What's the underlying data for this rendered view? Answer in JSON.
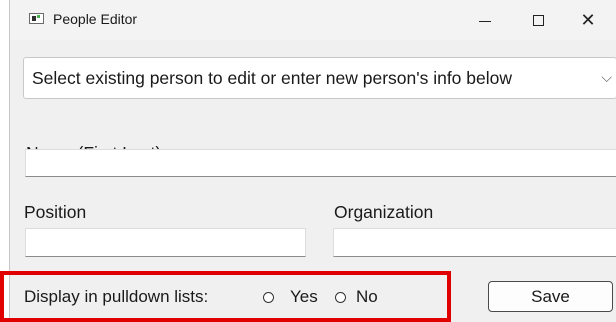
{
  "window": {
    "title": "People Editor",
    "controls": {
      "minimize_icon": "minimize-icon",
      "maximize_icon": "maximize-icon",
      "close_symbol": "✕"
    }
  },
  "person_select": {
    "value": "Select existing person to edit or enter new person's info below",
    "arrow": "⌵"
  },
  "fields": {
    "name_label": "Name (First Last)",
    "name_value": "",
    "position_label": "Position",
    "position_value": "",
    "organization_label": "Organization",
    "organization_value": ""
  },
  "display_option": {
    "label": "Display in pulldown lists:",
    "yes_label": "Yes",
    "no_label": "No",
    "selected": "none"
  },
  "actions": {
    "save_label": "Save"
  },
  "colors": {
    "highlight": "#e00000"
  }
}
